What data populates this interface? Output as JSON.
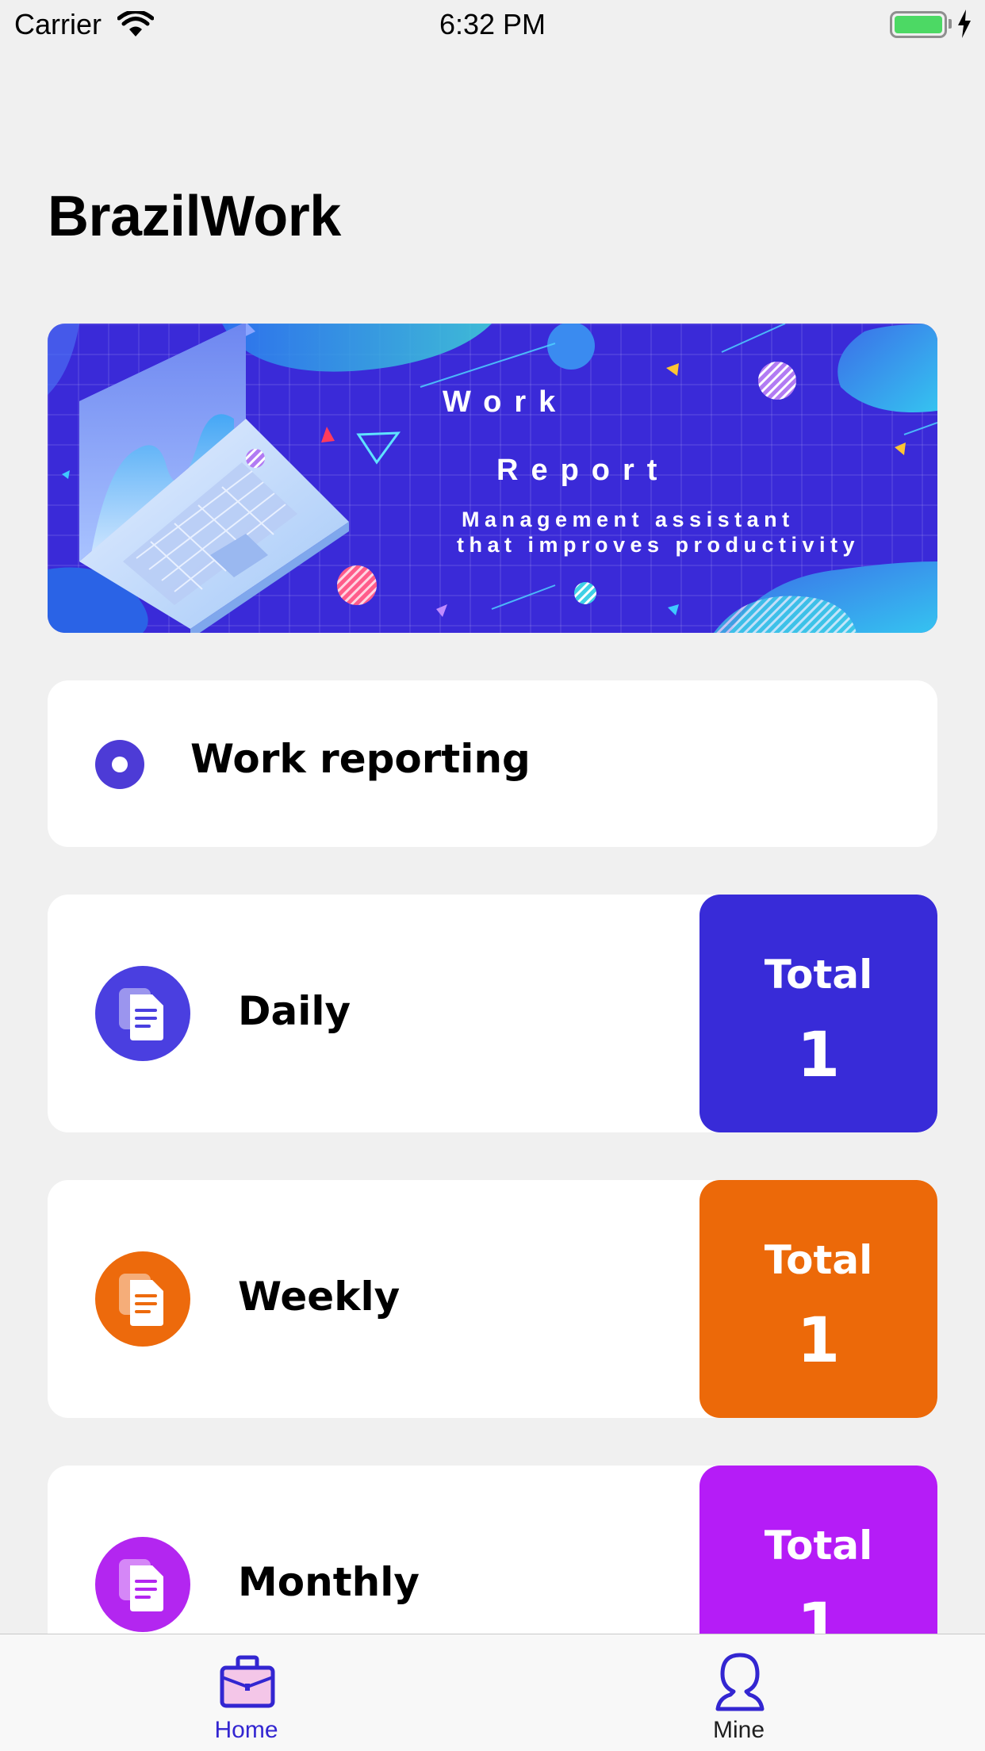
{
  "status_bar": {
    "carrier": "Carrier",
    "time": "6:32 PM"
  },
  "app": {
    "title": "BrazilWork"
  },
  "banner": {
    "title_line1": "Work",
    "title_line2": "Report",
    "subtitle_line1": "Management assistant",
    "subtitle_line2": "that improves productivity"
  },
  "section": {
    "title": "Work reporting"
  },
  "reports": [
    {
      "label": "Daily",
      "total_label": "Total",
      "total_value": "1",
      "color": "#382bd8",
      "icon_bg": "#4a3fe0"
    },
    {
      "label": "Weekly",
      "total_label": "Total",
      "total_value": "1",
      "color": "#ec6909",
      "icon_bg": "#ed6a0c"
    },
    {
      "label": "Monthly",
      "total_label": "Total",
      "total_value": "1",
      "color": "#b51cf7",
      "icon_bg": "#b326f0"
    }
  ],
  "tab_bar": {
    "tabs": [
      {
        "label": "Home",
        "icon": "briefcase-icon",
        "active": true
      },
      {
        "label": "Mine",
        "icon": "user-icon",
        "active": false
      }
    ],
    "active_color": "#3326d1",
    "inactive_color": "#1f1f1f"
  }
}
